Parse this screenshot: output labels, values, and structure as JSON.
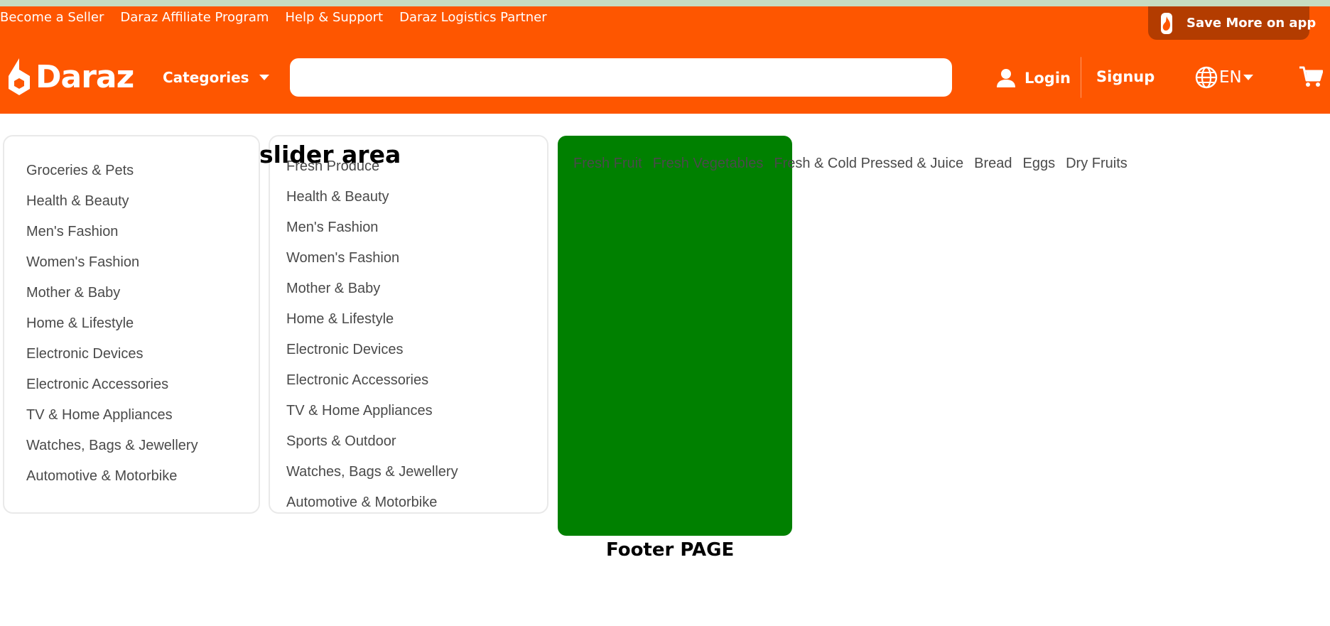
{
  "top_links": [
    "Become a Seller",
    "Daraz Affiliate Program",
    "Help & Support",
    "Daraz Logistics Partner"
  ],
  "app_promo": {
    "label": "Save More on app"
  },
  "brand": {
    "name": "Daraz"
  },
  "header": {
    "categories_label": "Categories",
    "search_placeholder": "",
    "login_label": "Login",
    "signup_label": "Signup",
    "language": "EN"
  },
  "sidebar_categories": [
    "Groceries & Pets",
    "Health & Beauty",
    "Men's Fashion",
    "Women's Fashion",
    "Mother & Baby",
    "Home & Lifestyle",
    "Electronic Devices",
    "Electronic Accessories",
    "TV & Home Appliances",
    "Watches, Bags & Jewellery",
    "Automotive & Motorbike"
  ],
  "submenu_categories": [
    "Fresh Produce",
    "Health & Beauty",
    "Men's Fashion",
    "Women's Fashion",
    "Mother & Baby",
    "Home & Lifestyle",
    "Electronic Devices",
    "Electronic Accessories",
    "TV & Home Appliances",
    "Sports & Outdoor",
    "Watches, Bags & Jewellery",
    "Automotive & Motorbike"
  ],
  "slider_title": "slider area",
  "subcategories": [
    "Fresh Fruit",
    "Fresh Vegetables",
    "Fresh & Cold Pressed & Juice",
    "Bread",
    "Eggs",
    "Dry Fruits"
  ],
  "footer_label": "Footer PAGE",
  "colors": {
    "header_orange": "#fe5600",
    "slider_green": "#008000",
    "promo_dark": "#b33c00"
  }
}
